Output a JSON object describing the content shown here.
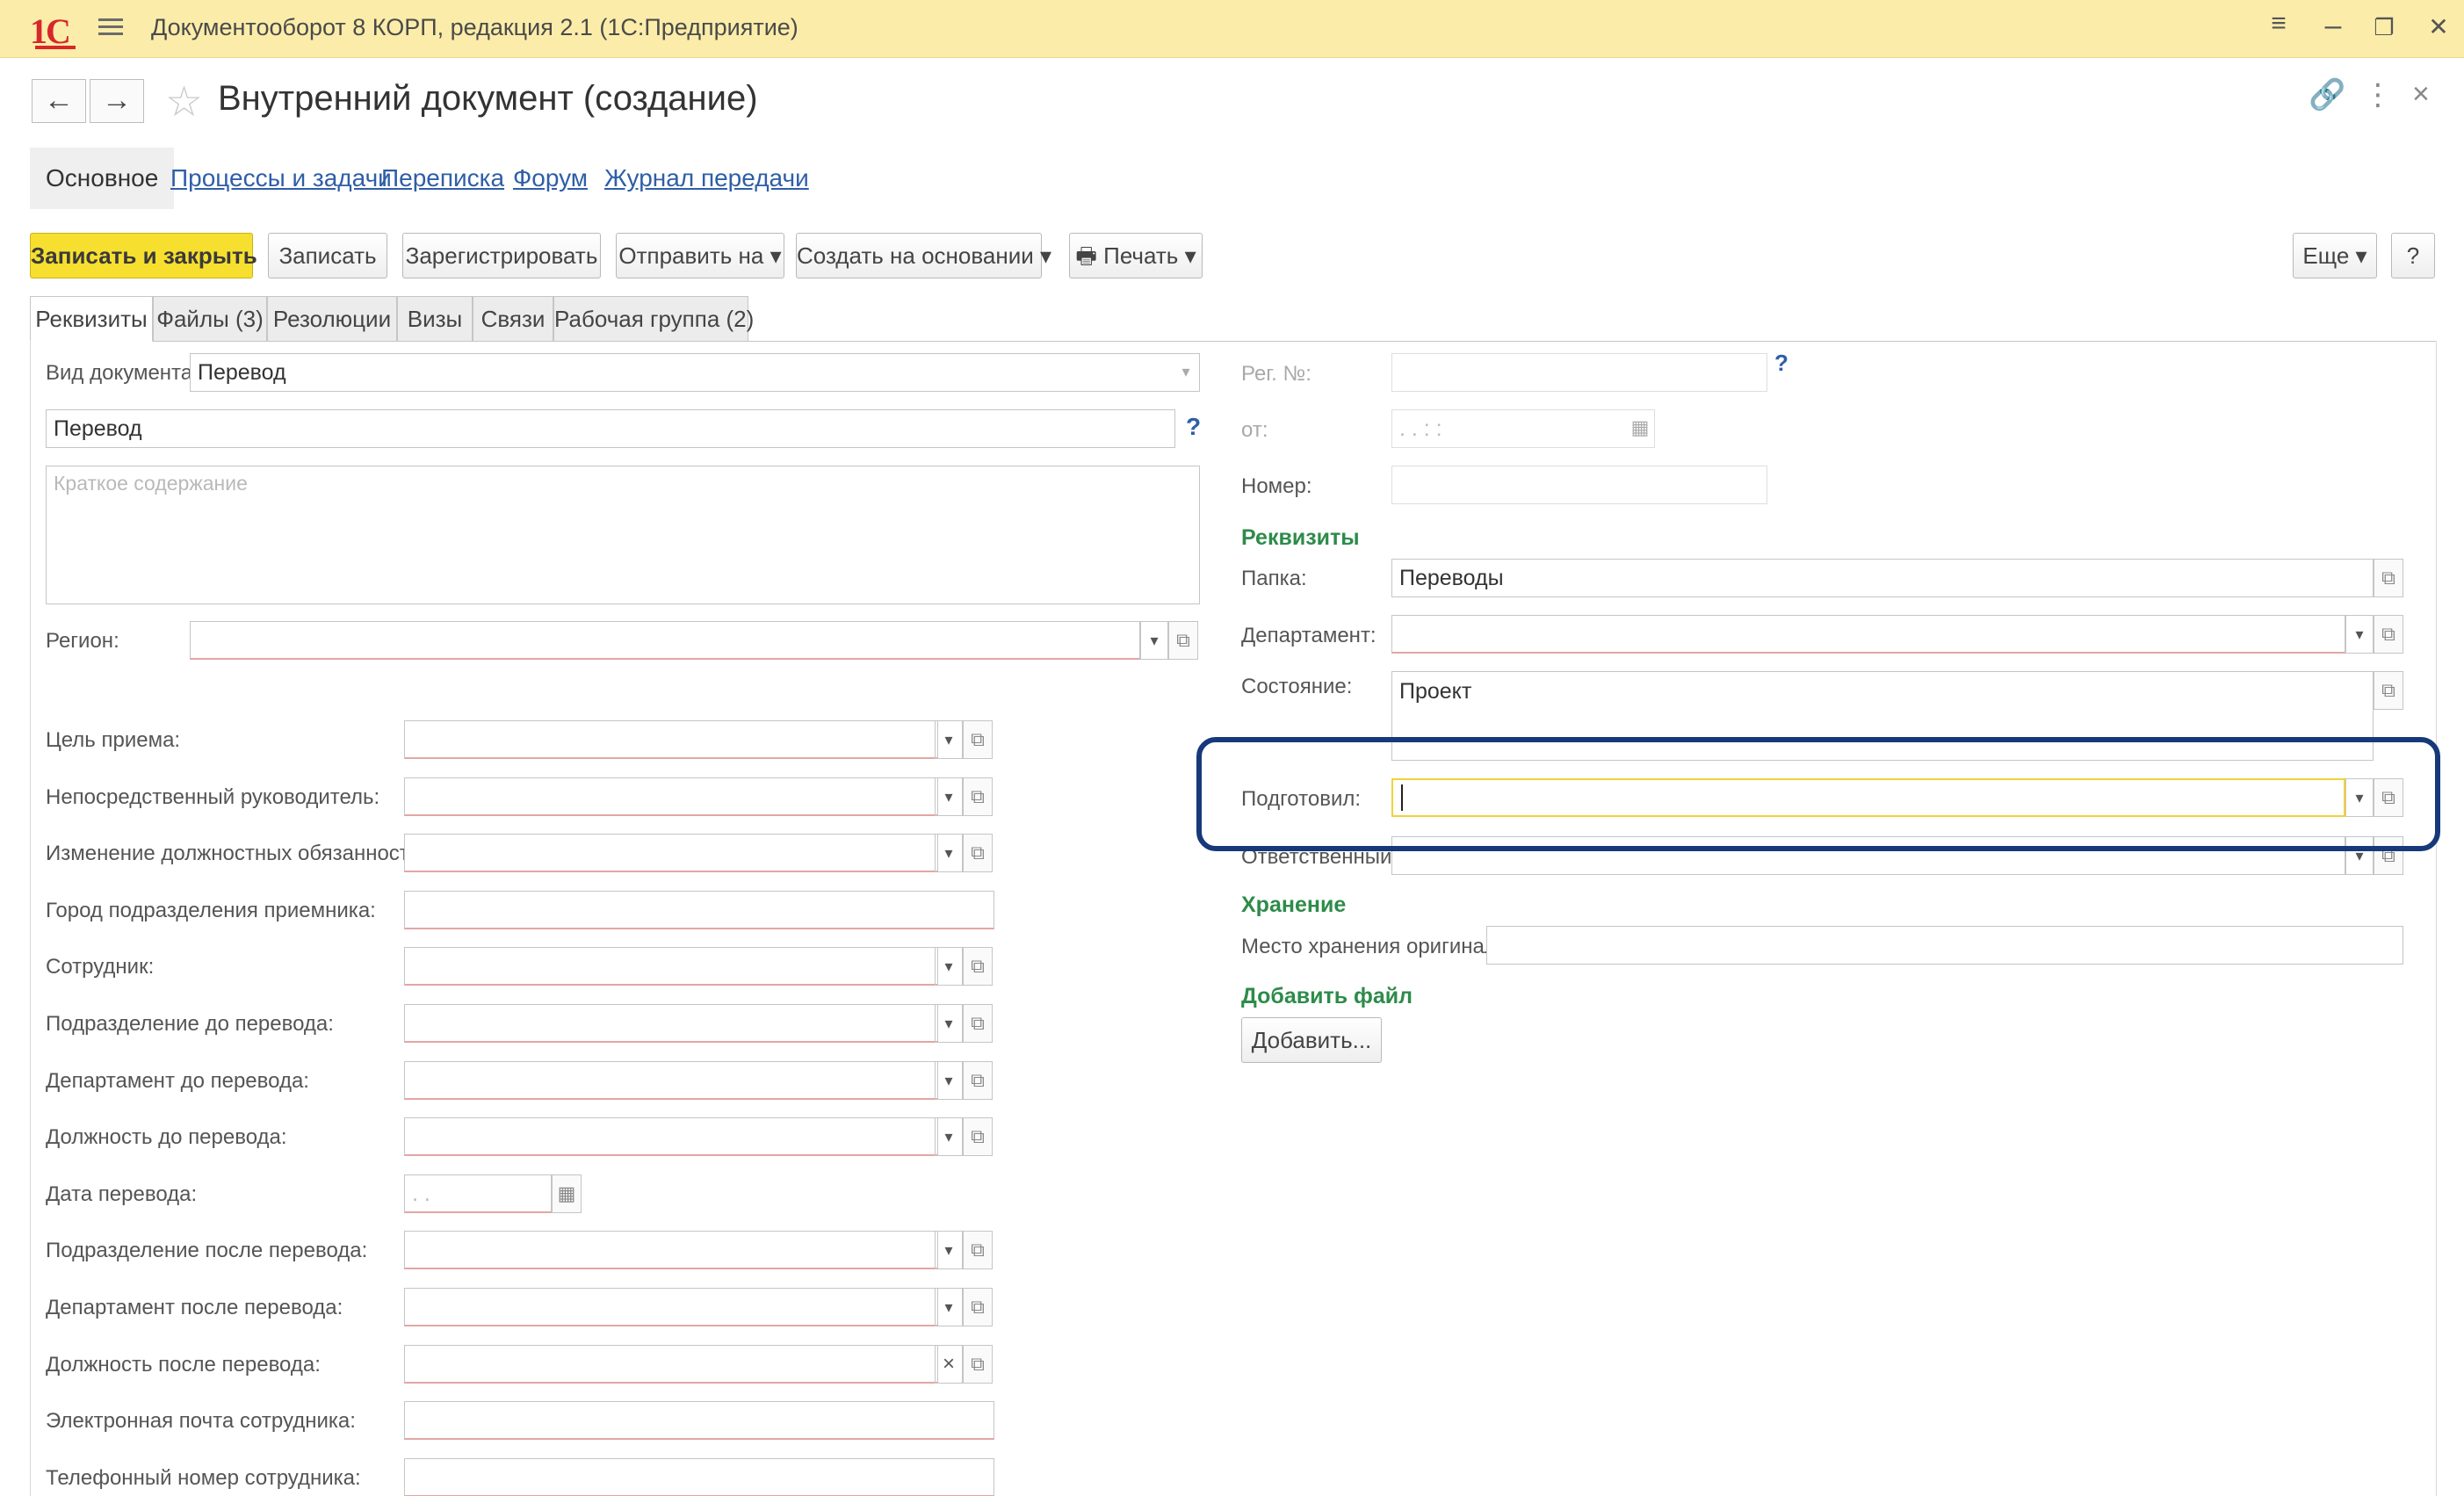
{
  "titlebar": {
    "logo": "1С",
    "title": "Документооборот 8 КОРП, редакция 2.1  (1С:Предприятие)",
    "controls": {
      "menu": "≡",
      "minimize": "–",
      "restore": "❐",
      "close": "✕"
    }
  },
  "header": {
    "back_icon": "←",
    "forward_icon": "→",
    "star_icon": "☆",
    "title": "Внутренний документ (создание)",
    "link_icon": "🔗",
    "more_icon": "⋮",
    "close_icon": "×"
  },
  "sections": {
    "active": "Основное",
    "links": [
      "Процессы и задачи",
      "Переписка",
      "Форум",
      "Журнал передачи"
    ]
  },
  "commands": {
    "save_close": "Записать и закрыть",
    "save": "Записать",
    "register": "Зарегистрировать",
    "send": "Отправить на",
    "create_based": "Создать на основании",
    "print": "Печать",
    "more": "Еще",
    "help": "?"
  },
  "tabs": [
    "Реквизиты",
    "Файлы (3)",
    "Резолюции",
    "Визы",
    "Связи",
    "Рабочая группа (2)"
  ],
  "left": {
    "doc_kind_label": "Вид документа:",
    "doc_kind_value": "Перевод",
    "name_value": "Перевод",
    "summary_placeholder": "Краткое содержание",
    "region_label": "Регион:",
    "fields": [
      {
        "label": "Цель приема:",
        "type": "dropdown"
      },
      {
        "label": "Непосредственный руководитель:",
        "type": "dropdown"
      },
      {
        "label": "Изменение должностных обязанностей:",
        "type": "dropdown"
      },
      {
        "label": "Город подразделения приемника:",
        "type": "text"
      },
      {
        "label": "Сотрудник:",
        "type": "dropdown"
      },
      {
        "label": "Подразделение до перевода:",
        "type": "dropdown"
      },
      {
        "label": "Департамент до перевода:",
        "type": "dropdown"
      },
      {
        "label": "Должность до перевода:",
        "type": "dropdown"
      },
      {
        "label": "Дата перевода:",
        "type": "date"
      },
      {
        "label": "Подразделение после перевода:",
        "type": "dropdown"
      },
      {
        "label": "Департамент после перевода:",
        "type": "dropdown"
      },
      {
        "label": "Должность после перевода:",
        "type": "clear"
      },
      {
        "label": "Электронная почта сотрудника:",
        "type": "text"
      },
      {
        "label": "Телефонный номер сотрудника:",
        "type": "text"
      }
    ],
    "date_placeholder": " .  .    "
  },
  "right": {
    "reg_no_label": "Рег. №:",
    "from_label": "от:",
    "from_placeholder": "  .  .       :  :",
    "number_label": "Номер:",
    "requisites_title": "Реквизиты",
    "folder_label": "Папка:",
    "folder_value": "Переводы",
    "department_label": "Департамент:",
    "state_label": "Состояние:",
    "state_value": "Проект",
    "prepared_label": "Подготовил:",
    "responsible_label": "Ответственный:",
    "storage_title": "Хранение",
    "storage_label": "Место хранения оригинала:",
    "add_file_title": "Добавить файл",
    "add_button": "Добавить..."
  },
  "icons": {
    "dropdown": "▾",
    "open": "⧉",
    "calendar": "▦",
    "clear": "×",
    "printer": "🖶"
  }
}
